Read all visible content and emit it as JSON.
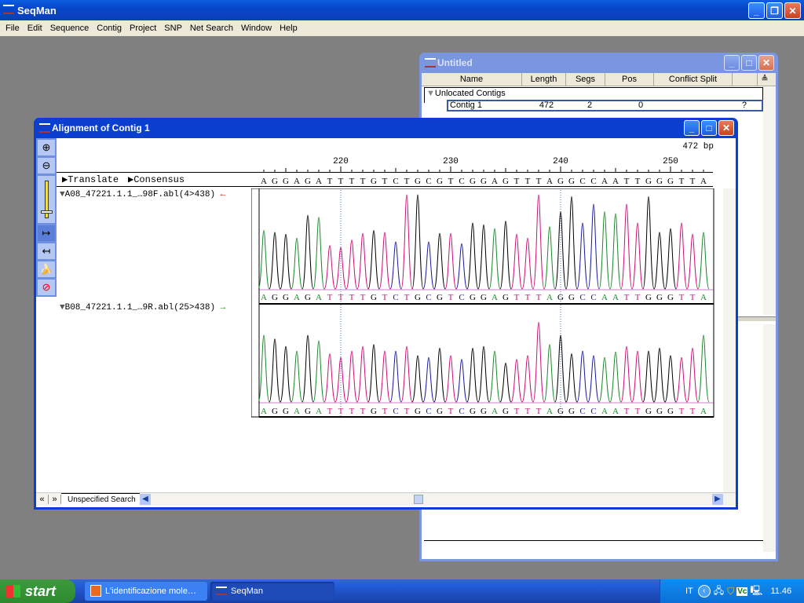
{
  "app": {
    "title": "SeqMan"
  },
  "menu": [
    "File",
    "Edit",
    "Sequence",
    "Contig",
    "Project",
    "SNP",
    "Net Search",
    "Window",
    "Help"
  ],
  "project_window": {
    "title": "Untitled",
    "columns": [
      "Name",
      "Length",
      "Segs",
      "Pos",
      "Conflict Split"
    ],
    "group_label": "Unlocated Contigs",
    "rows": [
      {
        "name": "Contig 1",
        "length": "472",
        "segs": "2",
        "pos": "0",
        "conflict_split": "?"
      }
    ]
  },
  "alignment_window": {
    "title": "Alignment of Contig 1",
    "length_label": "472 bp",
    "translate_label": "Translate",
    "consensus_label": "Consensus",
    "ruler_ticks": [
      "220",
      "230",
      "240",
      "250"
    ],
    "ruler_start": 213,
    "consensus": "AGGAGATTTTGTCTGCGTCGGAGTTTAGGCCAATTGGGTTA",
    "base_colors": {
      "A": "#1a8a2a",
      "G": "#000000",
      "T": "#d0107a",
      "C": "#1a1aa0"
    },
    "reads": [
      {
        "name": "A08_47221.1.1_…98F.abl(4>438)",
        "direction": "reverse",
        "arrow": "←",
        "arrow_color": "#c00000",
        "sequence": "AGGAGATTTTGTCTGCGTCGGAGTTTAGGCCAATTGGGTTA"
      },
      {
        "name": "B08_47221.1.1_…9R.abl(25>438)",
        "direction": "forward",
        "arrow": "→",
        "arrow_color": "#1a8a2a",
        "sequence": "AGGAGATTTTGTCTGCGTCGGAGTTTAGGCCAATTGGGTTA"
      }
    ],
    "search_label": "Unspecified Search",
    "tools": [
      "zoom-in",
      "zoom-out",
      "trace-scale-slider",
      "align-right",
      "align-left",
      "banana",
      "no-edit"
    ]
  },
  "taskbar": {
    "start_label": "start",
    "tasks": [
      {
        "label": "L'identificazione mole…"
      },
      {
        "label": "SeqMan"
      }
    ],
    "language": "IT",
    "clock": "11.46"
  }
}
